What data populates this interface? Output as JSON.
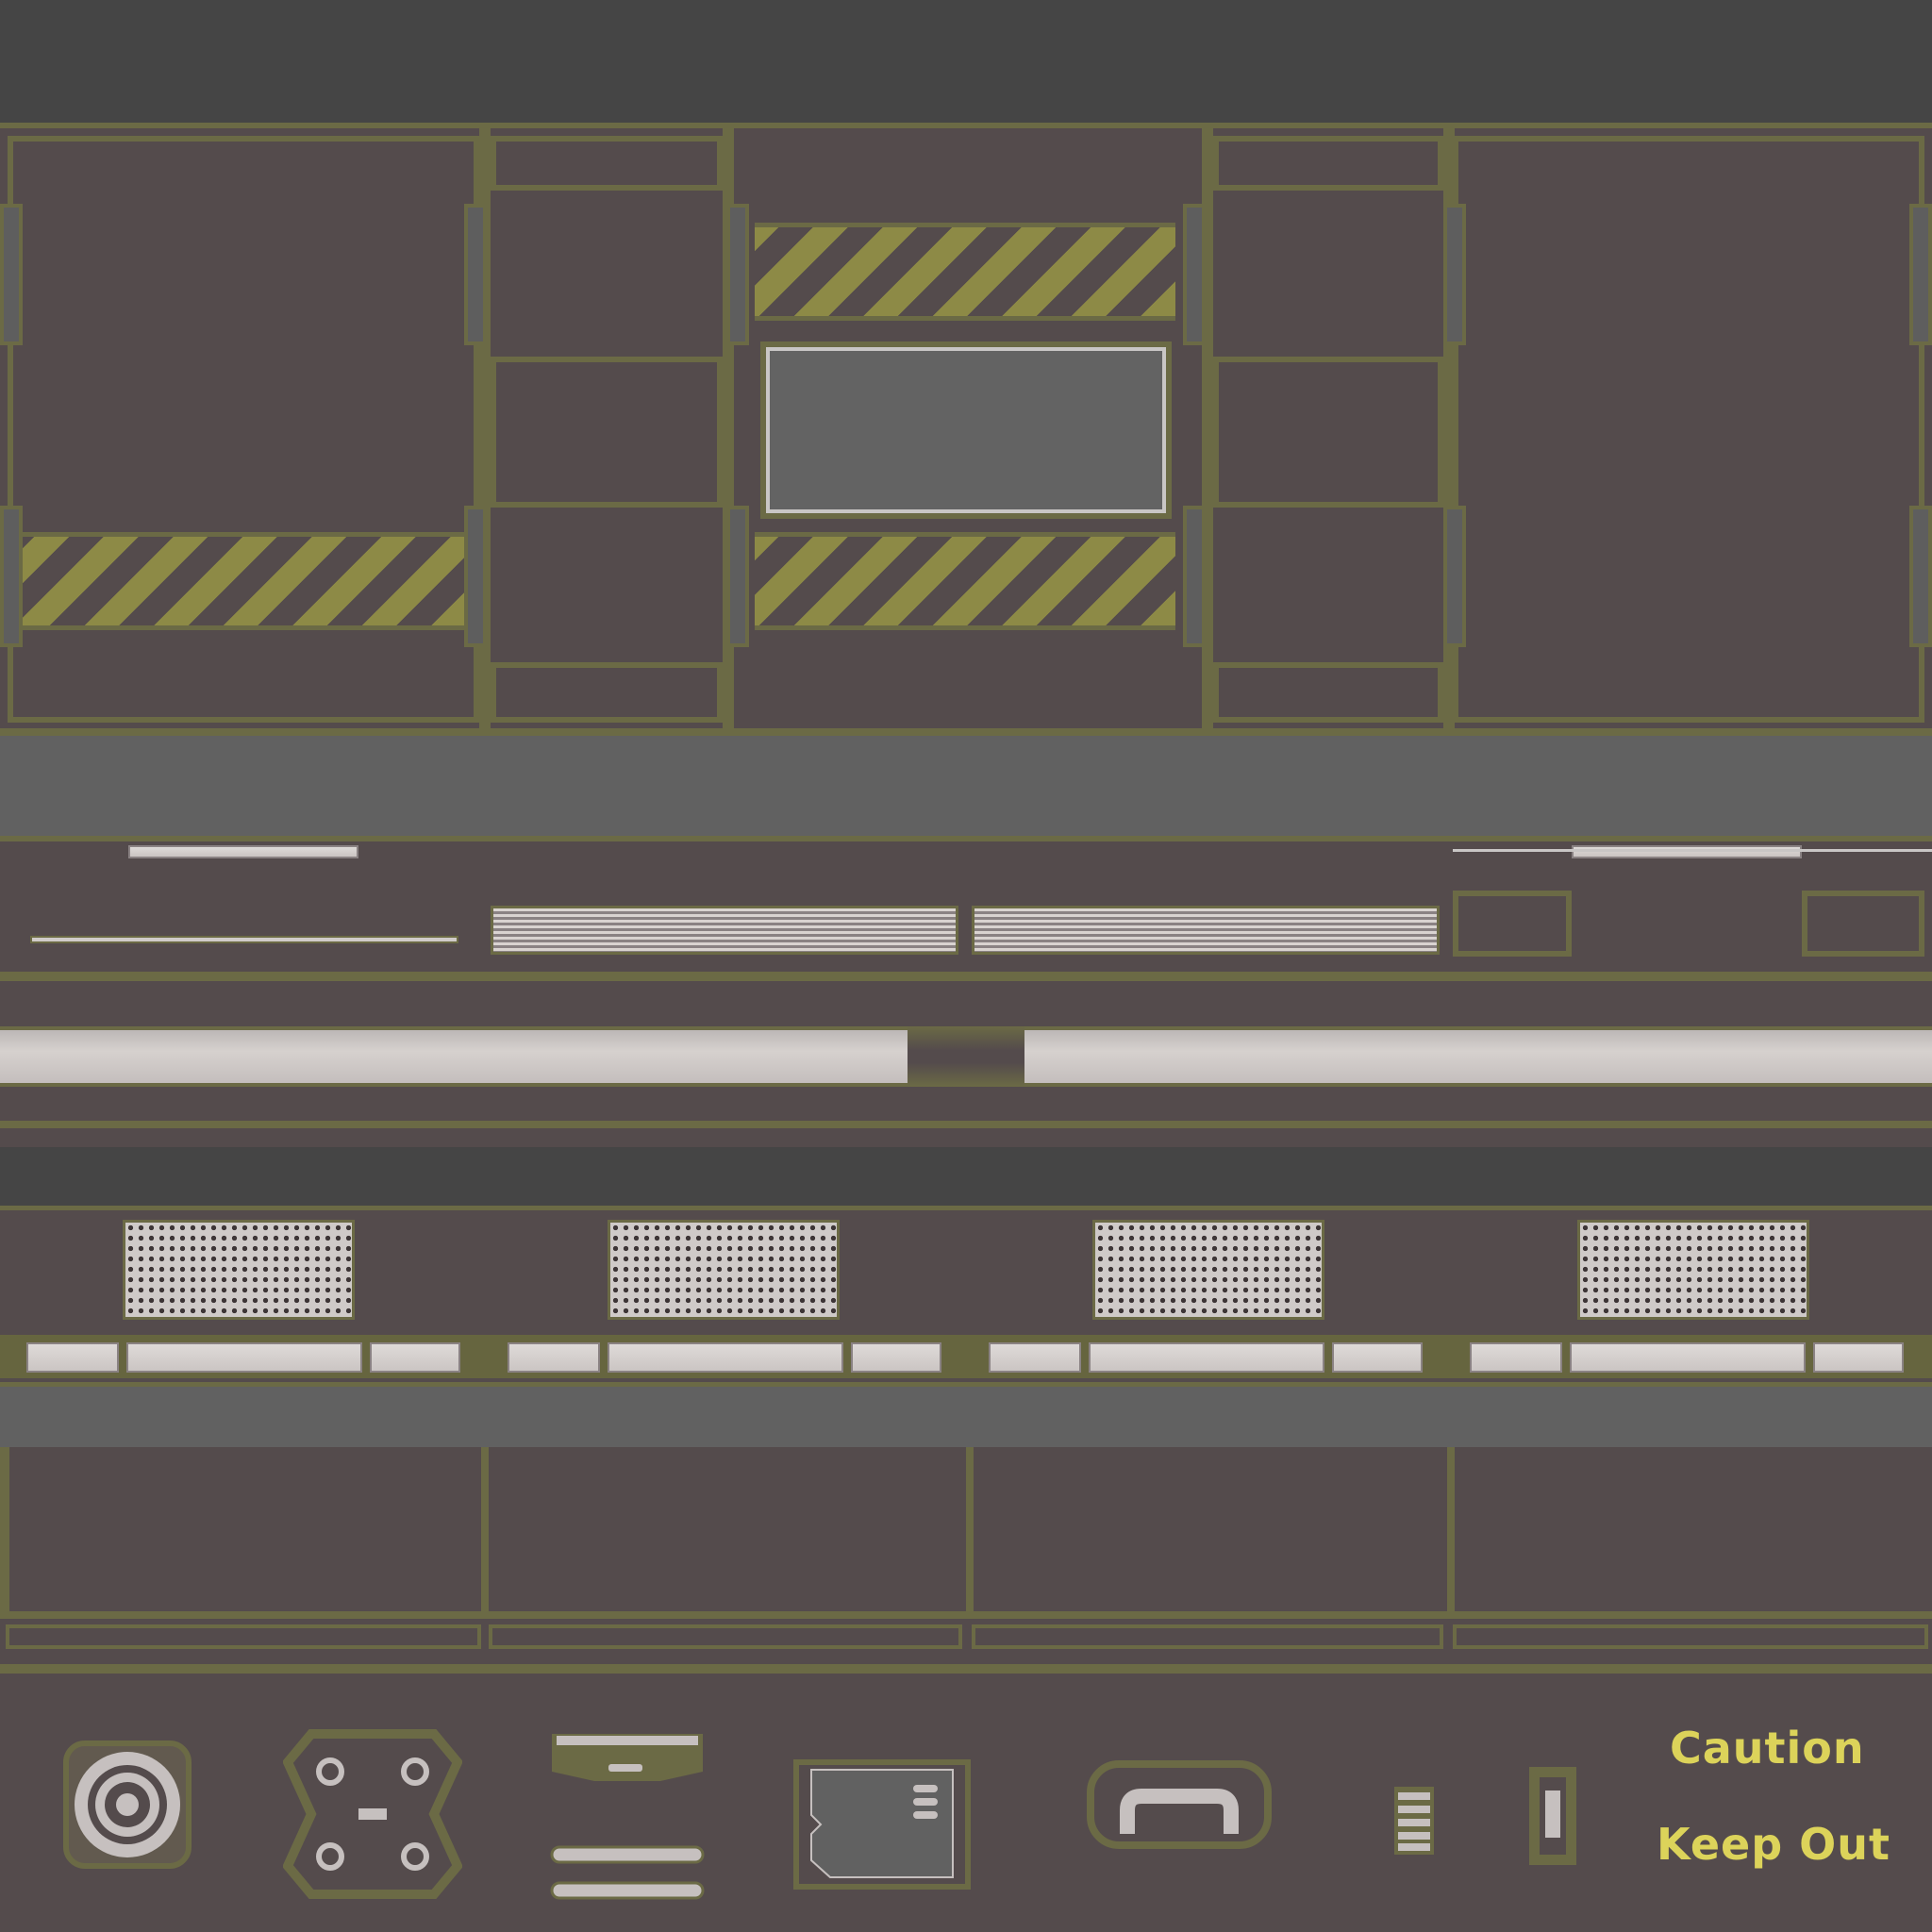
{
  "texture_sheet": {
    "palette": {
      "panel": "#544b4c",
      "frame": "#6b6a45",
      "hazard_stripe": "#8d8a46",
      "metal_light": "#d6d1ce",
      "window_grey": "#636363",
      "decal_yellow": "#dcd35a"
    },
    "decals": {
      "caution": "Caution",
      "keep_out": "Keep Out"
    },
    "icons": [
      "round-hatch-icon",
      "four-bolt-plate-icon",
      "slot-plate-icon",
      "sd-card-port-icon",
      "handle-icon",
      "vent-grille-icon",
      "switch-icon"
    ]
  }
}
